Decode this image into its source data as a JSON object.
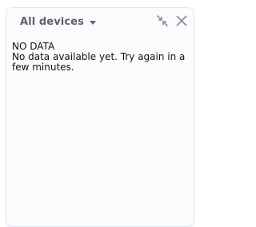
{
  "header": {
    "device_selector_label": "All devices",
    "icons": {
      "dropdown": "caret-down-icon",
      "collapse": "collapse-arrows-icon",
      "close": "close-icon"
    }
  },
  "empty_state": {
    "title": "NO DATA",
    "message": "No data available yet. Try again in a few minutes."
  },
  "colors": {
    "panel_background": "#fbfbfe",
    "panel_border": "#e6e8f1",
    "header_text": "#5c6170",
    "icon": "#8a8f9c",
    "body_text": "#111111"
  }
}
